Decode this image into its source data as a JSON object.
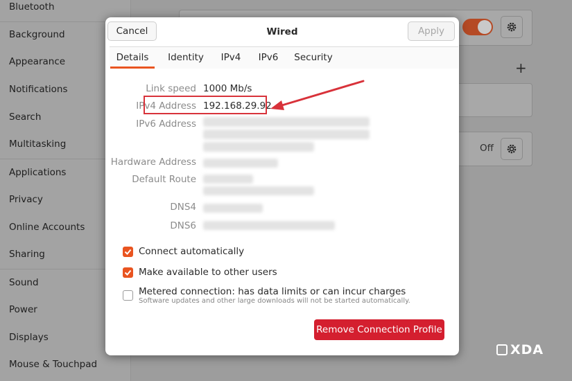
{
  "sidebar": {
    "items": [
      {
        "label": "Bluetooth"
      },
      {
        "label": "Background"
      },
      {
        "label": "Appearance"
      },
      {
        "label": "Notifications"
      },
      {
        "label": "Search"
      },
      {
        "label": "Multitasking"
      },
      {
        "label": "Applications"
      },
      {
        "label": "Privacy"
      },
      {
        "label": "Online Accounts"
      },
      {
        "label": "Sharing"
      },
      {
        "label": "Sound"
      },
      {
        "label": "Power"
      },
      {
        "label": "Displays"
      },
      {
        "label": "Mouse & Touchpad"
      }
    ]
  },
  "background_panel": {
    "off_label": "Off",
    "plus_label": "+"
  },
  "dialog": {
    "title": "Wired",
    "cancel_label": "Cancel",
    "apply_label": "Apply",
    "tabs": [
      {
        "label": "Details",
        "active": true
      },
      {
        "label": "Identity"
      },
      {
        "label": "IPv4"
      },
      {
        "label": "IPv6"
      },
      {
        "label": "Security"
      }
    ],
    "details": {
      "link_speed_label": "Link speed",
      "link_speed_value": "1000 Mb/s",
      "ipv4_label": "IPv4 Address",
      "ipv4_value": "192.168.29.92",
      "ipv6_label": "IPv6 Address",
      "hardware_label": "Hardware Address",
      "route_label": "Default Route",
      "dns4_label": "DNS4",
      "dns6_label": "DNS6"
    },
    "options": [
      {
        "label": "Connect automatically",
        "checked": true
      },
      {
        "label": "Make available to other users",
        "checked": true
      },
      {
        "label": "Metered connection: has data limits or can incur charges",
        "checked": false,
        "sublabel": "Software updates and other large downloads will not be started automatically."
      }
    ],
    "remove_label": "Remove Connection Profile"
  },
  "watermark": {
    "text": "XDA"
  },
  "colors": {
    "accent": "#e95420",
    "danger": "#d41f2f",
    "highlight": "#d8323a"
  }
}
